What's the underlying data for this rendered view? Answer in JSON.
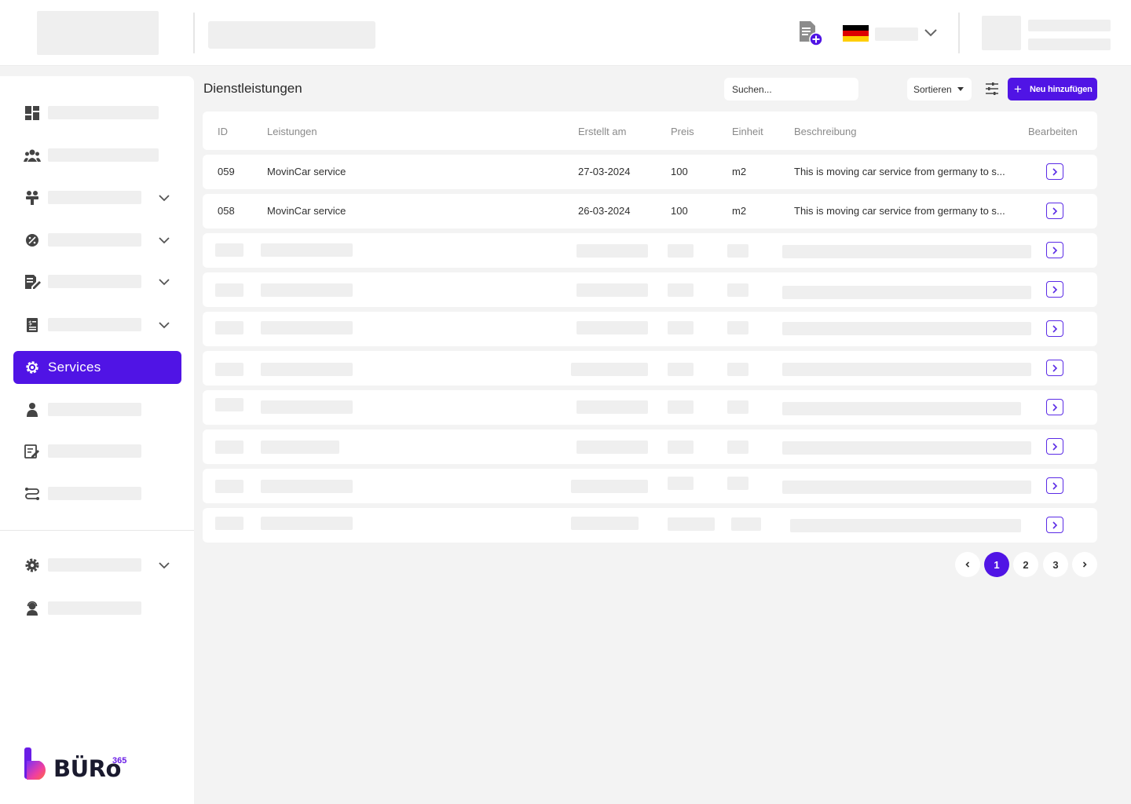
{
  "header": {
    "language_flag": "germany-flag-icon",
    "flag_colors": [
      "#000000",
      "#dd0000",
      "#ffce00"
    ]
  },
  "sidebar": {
    "active_item_label": "Services",
    "brand_name": "BÜRo",
    "brand_superscript": "365",
    "accent_color": "#5014e5"
  },
  "main": {
    "title": "Dienstleistungen",
    "search_placeholder": "Suchen...",
    "sort_label": "Sortieren",
    "add_label": "Neu hinzufügen",
    "columns": {
      "id": "ID",
      "service": "Leistungen",
      "created": "Erstellt am",
      "price": "Preis",
      "unit": "Einheit",
      "description": "Beschreibung",
      "edit": "Bearbeiten"
    },
    "rows": [
      {
        "id": "059",
        "service": "MovinCar service",
        "created": "27-03-2024",
        "price": "100",
        "unit": "m2",
        "description": "This is moving car service from germany to s..."
      },
      {
        "id": "058",
        "service": "MovinCar service",
        "created": "26-03-2024",
        "price": "100",
        "unit": "m2",
        "description": "This is moving car service from germany to s..."
      }
    ]
  },
  "pagination": {
    "pages": [
      "1",
      "2",
      "3"
    ],
    "current": "1"
  }
}
